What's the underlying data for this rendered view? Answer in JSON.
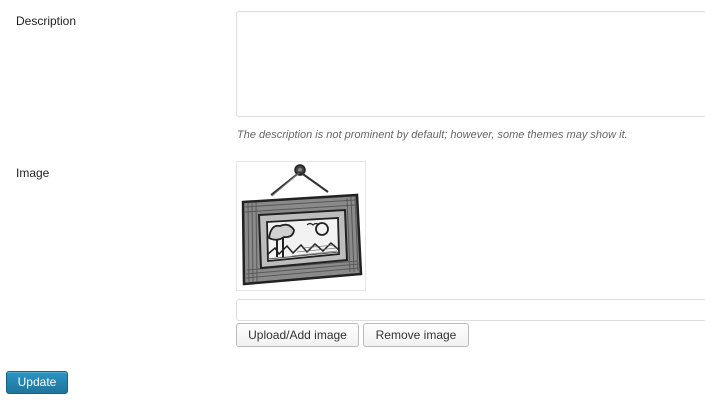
{
  "form": {
    "description_label": "Description",
    "description_value": "",
    "description_hint": "The description is not prominent by default; however, some themes may show it.",
    "image_label": "Image",
    "image_url_value": "",
    "upload_button": "Upload/Add image",
    "remove_button": "Remove image",
    "update_button": "Update"
  },
  "image": {
    "icon": "framed-picture-sketch-icon"
  },
  "colors": {
    "primary_button": "#21759b",
    "border": "#dddddd",
    "hint_text": "#666666"
  }
}
